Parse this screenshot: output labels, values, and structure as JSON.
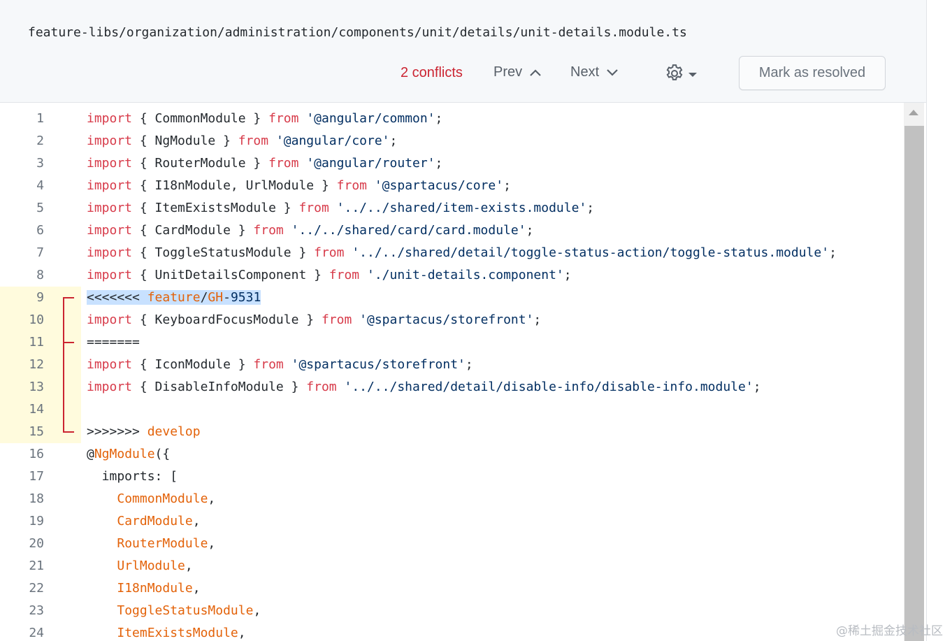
{
  "header": {
    "file_path": "feature-libs/organization/administration/components/unit/details/unit-details.module.ts",
    "conflicts_label": "2 conflicts",
    "prev_label": "Prev",
    "next_label": "Next",
    "resolve_label": "Mark as resolved",
    "settings_icon": "gear-icon"
  },
  "colors": {
    "conflict_count": "#cb2431",
    "keyword": "#d73a49",
    "string": "#032f62",
    "identifier": "#e36209",
    "conflict_gutter": "#fffbdd",
    "conflict_marker": "#cb2431",
    "selection": "#c8e1ff"
  },
  "editor": {
    "conflict_lines": [
      9,
      10,
      11,
      12,
      13,
      14,
      15
    ],
    "lines": [
      {
        "n": "1",
        "tokens": [
          [
            "kw",
            "import"
          ],
          [
            "p",
            " { CommonModule } "
          ],
          [
            "kw",
            "from"
          ],
          [
            "p",
            " "
          ],
          [
            "str",
            "'@angular/common'"
          ],
          [
            "p",
            ";"
          ]
        ]
      },
      {
        "n": "2",
        "tokens": [
          [
            "kw",
            "import"
          ],
          [
            "p",
            " { NgModule } "
          ],
          [
            "kw",
            "from"
          ],
          [
            "p",
            " "
          ],
          [
            "str",
            "'@angular/core'"
          ],
          [
            "p",
            ";"
          ]
        ]
      },
      {
        "n": "3",
        "tokens": [
          [
            "kw",
            "import"
          ],
          [
            "p",
            " { RouterModule } "
          ],
          [
            "kw",
            "from"
          ],
          [
            "p",
            " "
          ],
          [
            "str",
            "'@angular/router'"
          ],
          [
            "p",
            ";"
          ]
        ]
      },
      {
        "n": "4",
        "tokens": [
          [
            "kw",
            "import"
          ],
          [
            "p",
            " { I18nModule, UrlModule } "
          ],
          [
            "kw",
            "from"
          ],
          [
            "p",
            " "
          ],
          [
            "str",
            "'@spartacus/core'"
          ],
          [
            "p",
            ";"
          ]
        ]
      },
      {
        "n": "5",
        "tokens": [
          [
            "kw",
            "import"
          ],
          [
            "p",
            " { ItemExistsModule } "
          ],
          [
            "kw",
            "from"
          ],
          [
            "p",
            " "
          ],
          [
            "str",
            "'../../shared/item-exists.module'"
          ],
          [
            "p",
            ";"
          ]
        ]
      },
      {
        "n": "6",
        "tokens": [
          [
            "kw",
            "import"
          ],
          [
            "p",
            " { CardModule } "
          ],
          [
            "kw",
            "from"
          ],
          [
            "p",
            " "
          ],
          [
            "str",
            "'../../shared/card/card.module'"
          ],
          [
            "p",
            ";"
          ]
        ]
      },
      {
        "n": "7",
        "tokens": [
          [
            "kw",
            "import"
          ],
          [
            "p",
            " { ToggleStatusModule } "
          ],
          [
            "kw",
            "from"
          ],
          [
            "p",
            " "
          ],
          [
            "str",
            "'../../shared/detail/toggle-status-action/toggle-status.module'"
          ],
          [
            "p",
            ";"
          ]
        ]
      },
      {
        "n": "8",
        "tokens": [
          [
            "kw",
            "import"
          ],
          [
            "p",
            " { UnitDetailsComponent } "
          ],
          [
            "kw",
            "from"
          ],
          [
            "p",
            " "
          ],
          [
            "str",
            "'./unit-details.component'"
          ],
          [
            "p",
            ";"
          ]
        ]
      },
      {
        "n": "9",
        "tokens": [
          [
            "sel-p",
            "<<<<<<< "
          ],
          [
            "sel-orange",
            "feature"
          ],
          [
            "sel-p",
            "/"
          ],
          [
            "sel-orange",
            "GH"
          ],
          [
            "sel-p",
            "-"
          ],
          [
            "sel-str",
            "9531"
          ]
        ]
      },
      {
        "n": "10",
        "tokens": [
          [
            "kw",
            "import"
          ],
          [
            "p",
            " { KeyboardFocusModule } "
          ],
          [
            "kw",
            "from"
          ],
          [
            "p",
            " "
          ],
          [
            "str",
            "'@spartacus/storefront'"
          ],
          [
            "p",
            ";"
          ]
        ]
      },
      {
        "n": "11",
        "tokens": [
          [
            "p",
            "======="
          ]
        ]
      },
      {
        "n": "12",
        "tokens": [
          [
            "kw",
            "import"
          ],
          [
            "p",
            " { IconModule } "
          ],
          [
            "kw",
            "from"
          ],
          [
            "p",
            " "
          ],
          [
            "str",
            "'@spartacus/storefront'"
          ],
          [
            "p",
            ";"
          ]
        ]
      },
      {
        "n": "13",
        "tokens": [
          [
            "kw",
            "import"
          ],
          [
            "p",
            " { DisableInfoModule } "
          ],
          [
            "kw",
            "from"
          ],
          [
            "p",
            " "
          ],
          [
            "str",
            "'../../shared/detail/disable-info/disable-info.module'"
          ],
          [
            "p",
            ";"
          ]
        ]
      },
      {
        "n": "14",
        "tokens": []
      },
      {
        "n": "15",
        "tokens": [
          [
            "p",
            ">>>>>>> "
          ],
          [
            "orange",
            "develop"
          ]
        ]
      },
      {
        "n": "16",
        "tokens": [
          [
            "p",
            "@"
          ],
          [
            "orange",
            "NgModule"
          ],
          [
            "p",
            "({"
          ]
        ]
      },
      {
        "n": "17",
        "tokens": [
          [
            "p",
            "  imports: ["
          ]
        ]
      },
      {
        "n": "18",
        "tokens": [
          [
            "p",
            "    "
          ],
          [
            "orange",
            "CommonModule"
          ],
          [
            "p",
            ","
          ]
        ]
      },
      {
        "n": "19",
        "tokens": [
          [
            "p",
            "    "
          ],
          [
            "orange",
            "CardModule"
          ],
          [
            "p",
            ","
          ]
        ]
      },
      {
        "n": "20",
        "tokens": [
          [
            "p",
            "    "
          ],
          [
            "orange",
            "RouterModule"
          ],
          [
            "p",
            ","
          ]
        ]
      },
      {
        "n": "21",
        "tokens": [
          [
            "p",
            "    "
          ],
          [
            "orange",
            "UrlModule"
          ],
          [
            "p",
            ","
          ]
        ]
      },
      {
        "n": "22",
        "tokens": [
          [
            "p",
            "    "
          ],
          [
            "orange",
            "I18nModule"
          ],
          [
            "p",
            ","
          ]
        ]
      },
      {
        "n": "23",
        "tokens": [
          [
            "p",
            "    "
          ],
          [
            "orange",
            "ToggleStatusModule"
          ],
          [
            "p",
            ","
          ]
        ]
      },
      {
        "n": "24",
        "tokens": [
          [
            "p",
            "    "
          ],
          [
            "orange",
            "ItemExistsModule"
          ],
          [
            "p",
            ","
          ]
        ]
      }
    ]
  },
  "watermark": "@稀土掘金技术社区"
}
